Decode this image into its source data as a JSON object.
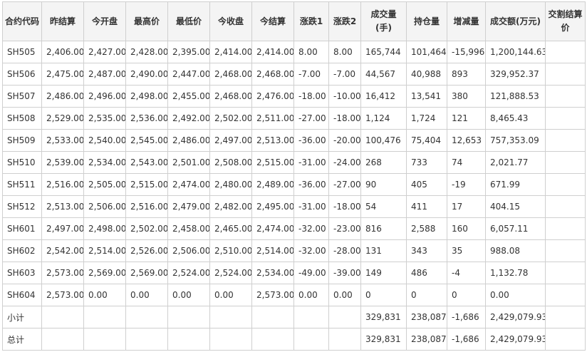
{
  "table": {
    "headers": [
      "合约代码",
      "昨结算",
      "今开盘",
      "最高价",
      "最低价",
      "今收盘",
      "今结算",
      "涨跌1",
      "涨跌2",
      "成交量(手)",
      "持仓量",
      "增减量",
      "成交额(万元)",
      "交割结算价"
    ],
    "rows": [
      [
        "SH505",
        "2,406.00",
        "2,427.00",
        "2,428.00",
        "2,395.00",
        "2,414.00",
        "2,414.00",
        "8.00",
        "8.00",
        "165,744",
        "101,464",
        "-15,996",
        "1,200,144.63",
        ""
      ],
      [
        "SH506",
        "2,475.00",
        "2,487.00",
        "2,490.00",
        "2,447.00",
        "2,468.00",
        "2,468.00",
        "-7.00",
        "-7.00",
        "44,567",
        "40,988",
        "893",
        "329,952.37",
        ""
      ],
      [
        "SH507",
        "2,486.00",
        "2,496.00",
        "2,498.00",
        "2,455.00",
        "2,468.00",
        "2,476.00",
        "-18.00",
        "-10.00",
        "16,412",
        "13,541",
        "380",
        "121,888.53",
        ""
      ],
      [
        "SH508",
        "2,529.00",
        "2,535.00",
        "2,536.00",
        "2,492.00",
        "2,502.00",
        "2,511.00",
        "-27.00",
        "-18.00",
        "1,124",
        "1,724",
        "121",
        "8,465.43",
        ""
      ],
      [
        "SH509",
        "2,533.00",
        "2,540.00",
        "2,545.00",
        "2,486.00",
        "2,497.00",
        "2,513.00",
        "-36.00",
        "-20.00",
        "100,476",
        "75,404",
        "12,653",
        "757,353.09",
        ""
      ],
      [
        "SH510",
        "2,539.00",
        "2,534.00",
        "2,543.00",
        "2,501.00",
        "2,508.00",
        "2,515.00",
        "-31.00",
        "-24.00",
        "268",
        "733",
        "74",
        "2,021.77",
        ""
      ],
      [
        "SH511",
        "2,516.00",
        "2,505.00",
        "2,515.00",
        "2,474.00",
        "2,480.00",
        "2,489.00",
        "-36.00",
        "-27.00",
        "90",
        "405",
        "-19",
        "671.99",
        ""
      ],
      [
        "SH512",
        "2,513.00",
        "2,506.00",
        "2,516.00",
        "2,479.00",
        "2,482.00",
        "2,495.00",
        "-31.00",
        "-18.00",
        "54",
        "411",
        "17",
        "404.15",
        ""
      ],
      [
        "SH601",
        "2,497.00",
        "2,498.00",
        "2,502.00",
        "2,458.00",
        "2,465.00",
        "2,474.00",
        "-32.00",
        "-23.00",
        "816",
        "2,588",
        "160",
        "6,057.11",
        ""
      ],
      [
        "SH602",
        "2,542.00",
        "2,514.00",
        "2,526.00",
        "2,506.00",
        "2,510.00",
        "2,514.00",
        "-32.00",
        "-28.00",
        "131",
        "343",
        "35",
        "988.08",
        ""
      ],
      [
        "SH603",
        "2,573.00",
        "2,569.00",
        "2,569.00",
        "2,524.00",
        "2,524.00",
        "2,534.00",
        "-49.00",
        "-39.00",
        "149",
        "486",
        "-4",
        "1,132.78",
        ""
      ],
      [
        "SH604",
        "2,573.00",
        "0.00",
        "0.00",
        "0.00",
        "0.00",
        "2,573.00",
        "0.00",
        "0.00",
        "0",
        "0",
        "0",
        "0.00",
        ""
      ],
      [
        "小计",
        "",
        "",
        "",
        "",
        "",
        "",
        "",
        "",
        "329,831",
        "238,087",
        "-1,686",
        "2,429,079.93",
        ""
      ],
      [
        "总计",
        "",
        "",
        "",
        "",
        "",
        "",
        "",
        "",
        "329,831",
        "238,087",
        "-1,686",
        "2,429,079.93",
        ""
      ]
    ]
  }
}
